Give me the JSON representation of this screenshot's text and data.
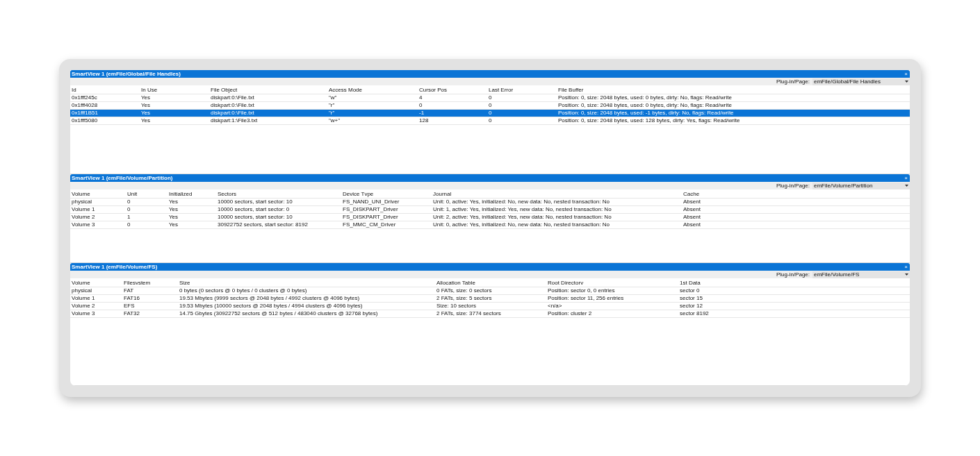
{
  "panels": [
    {
      "title": "SmartView 1 (emFile/Global/File Handles)",
      "close": "×",
      "plugin_label": "Plug-in/Page:",
      "plugin_value": "emFile/Global/File Handles",
      "columns": [
        "Id",
        "In Use",
        "File Object",
        "Access Mode",
        "Cursor Pos",
        "Last Error",
        "File Buffer"
      ],
      "rows": [
        {
          "selected": false,
          "cells": [
            "0x1fff245c",
            "Yes",
            "diskpart:0:\\File.txt",
            "\"w\"",
            "4",
            "0",
            "Position: 0, size: 2048 bytes, used: 0 bytes, dirty: No, flags: Read/write"
          ]
        },
        {
          "selected": false,
          "cells": [
            "0x1fff4028",
            "Yes",
            "diskpart:0:\\File.txt",
            "\"r\"",
            "0",
            "0",
            "Position: 0, size: 2048 bytes, used: 0 bytes, dirty: No, flags: Read/write"
          ]
        },
        {
          "selected": true,
          "cells": [
            "0x1fff1B51",
            "Yes",
            "diskpart:0:\\File.txt",
            "\"r\"",
            "-1",
            "0",
            "Position: 0, size: 2048 bytes, used: -1 bytes, dirty: No, flags: Read/write"
          ]
        },
        {
          "selected": false,
          "cells": [
            "0x1fff5080",
            "Yes",
            "diskpart:1:\\File3.txt",
            "\"w+\"",
            "128",
            "0",
            "Position: 0, size: 2048 bytes, used: 128 bytes, dirty: Yes, flags: Read/write"
          ]
        }
      ]
    },
    {
      "title": "SmartView 1 (emFile/Volume/Partition)",
      "close": "×",
      "plugin_label": "Plug-in/Page:",
      "plugin_value": "emFile/Volume/Partition",
      "columns": [
        "Volume",
        "Unit",
        "Initialized",
        "Sectors",
        "Device Tvpe",
        "Journal",
        "Cache"
      ],
      "rows": [
        {
          "selected": false,
          "cells": [
            "physical",
            "0",
            "Yes",
            "10000 sectors, start sector: 10",
            "FS_NAND_UNI_Driver",
            "Unit: 0, active: Yes, initialized: No, new data: No, nested transaction: No",
            "Absent"
          ]
        },
        {
          "selected": false,
          "cells": [
            "Volume 1",
            "0",
            "Yes",
            "10000 sectors, start sector: 0",
            "FS_DISKPART_Driver",
            "Unit: 1, active: Yes, initialized: Yes, new data: No, nested transaction: No",
            "Absent"
          ]
        },
        {
          "selected": false,
          "cells": [
            "Volume 2",
            "1",
            "Yes",
            "10000 sectors, start sector: 10",
            "FS_DISKPART_Driver",
            "Unit: 2, active: Yes, initialized: Yes, new data: No, nested transaction: No",
            "Absent"
          ]
        },
        {
          "selected": false,
          "cells": [
            "Volume 3",
            "0",
            "Yes",
            "30922752 sectors, start sector: 8192",
            "FS_MMC_CM_Driver",
            "Unit: 0, active: Yes, initialized: No, new data: No, nested transaction: No",
            "Absent"
          ]
        }
      ]
    },
    {
      "title": "SmartView 1 (emFile/Volume/FS)",
      "close": "×",
      "plugin_label": "Plug-in/Page:",
      "plugin_value": "emFile/Volume/FS",
      "columns": [
        "Volume",
        "Filesvstem",
        "Size",
        "Allocation Table",
        "Root Directorv",
        "1st Data"
      ],
      "rows": [
        {
          "selected": false,
          "cells": [
            "physical",
            "FAT",
            "0 bytes (0 sectors @ 0 bytes / 0 clusters @ 0 bytes)",
            "0 FATs, size: 0 sectors",
            "Position: sector 0, 0 entries",
            "sector 0"
          ]
        },
        {
          "selected": false,
          "cells": [
            "Volume 1",
            "FAT16",
            "19.53 Mbytes (9999 sectors @ 2048 bytes / 4992 clusters @ 4096 bytes)",
            "2 FATs, size: 5 sectors",
            "Position: sector 11, 256 entries",
            "sector 15"
          ]
        },
        {
          "selected": false,
          "cells": [
            "Volume 2",
            "EFS",
            "19.53 Mbytes (10000 sectors @ 2048 bytes / 4994 clusters @ 4096 bytes)",
            "Size: 10 sectors",
            "<n/a>",
            "sector 12"
          ]
        },
        {
          "selected": false,
          "cells": [
            "Volume 3",
            "FAT32",
            "14.75 Gbytes (30922752 sectors @ 512 bytes / 483040 clusters @ 32768 bytes)",
            "2 FATs, size: 3774 sectors",
            "Position: cluster 2",
            "sector 8192"
          ]
        }
      ]
    }
  ]
}
